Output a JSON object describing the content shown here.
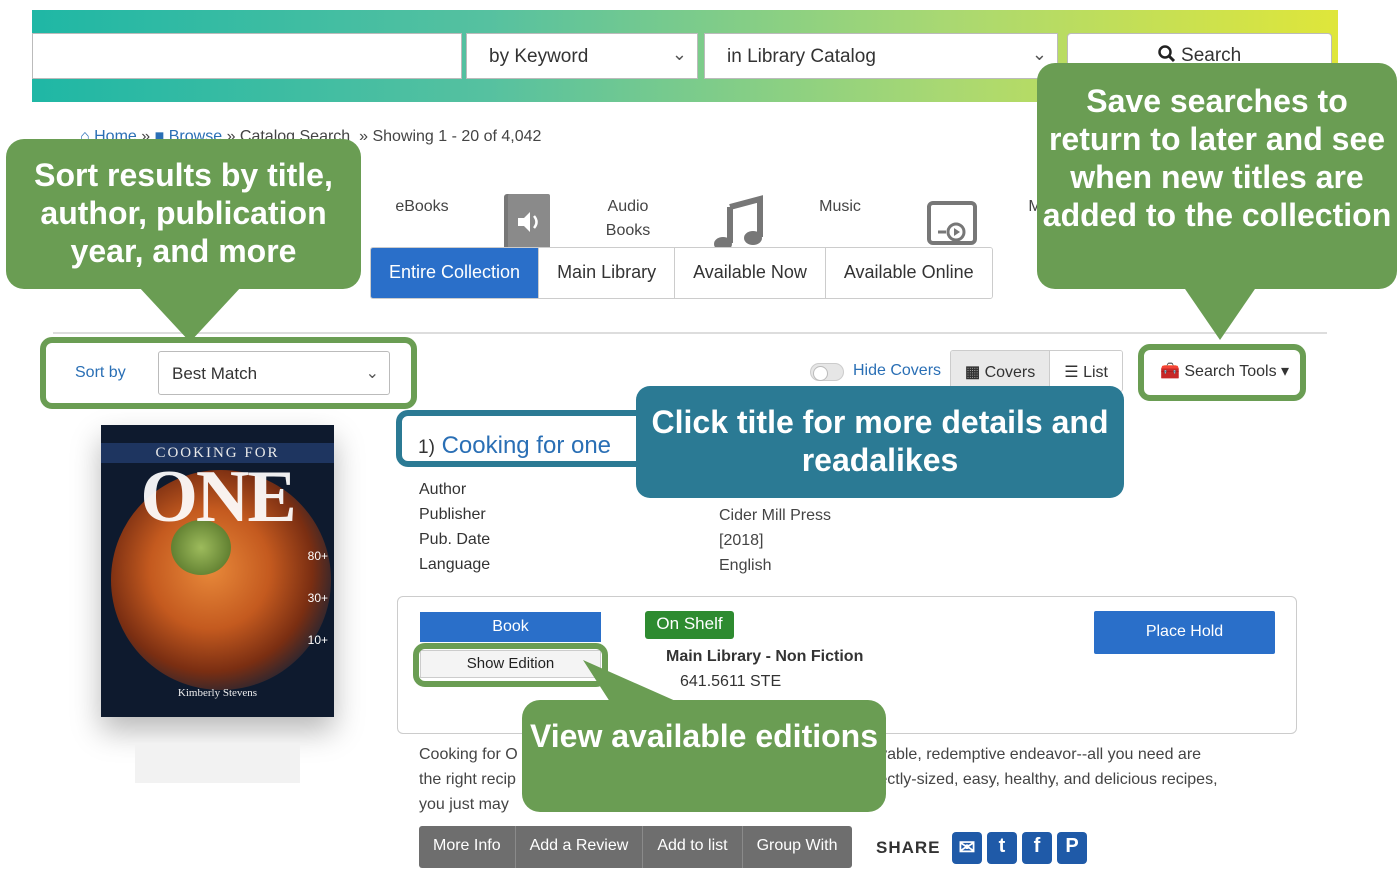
{
  "search": {
    "field_type": "by Keyword",
    "scope": "in Library Catalog",
    "button_label": "Search"
  },
  "breadcrumb": {
    "home": "Home",
    "browse": "Browse",
    "catalog": "» Catalog Search",
    "showing": "» Showing 1 - 20 of 4,042",
    "sep": "»"
  },
  "formats": [
    {
      "label": "eBooks",
      "icon": "ebook-icon"
    },
    {
      "label": "Audio Books",
      "icon": "audiobook-icon"
    },
    {
      "label": "Music",
      "icon": "music-note-icon"
    },
    {
      "label": "M",
      "icon": "video-icon"
    }
  ],
  "location_tabs": [
    {
      "label": "Entire Collection",
      "active": true
    },
    {
      "label": "Main Library",
      "active": false
    },
    {
      "label": "Available Now",
      "active": false
    },
    {
      "label": "Available Online",
      "active": false
    }
  ],
  "sort": {
    "label": "Sort by",
    "value": "Best Match"
  },
  "view": {
    "hide_covers": "Hide Covers",
    "covers": "Covers",
    "list": "List",
    "search_tools": "Search Tools"
  },
  "result": {
    "number": "1)",
    "title": "Cooking for one",
    "meta": [
      {
        "label": "Author",
        "value": ""
      },
      {
        "label": "Publisher",
        "value": "Cider Mill Press"
      },
      {
        "label": "Pub. Date",
        "value": "[2018]"
      },
      {
        "label": "Language",
        "value": "English"
      }
    ],
    "format_button": "Book",
    "show_edition": "Show Edition",
    "status": "On Shelf",
    "location": "Main Library - Non Fiction",
    "call_number": "641.5611 STE",
    "place_hold": "Place Hold",
    "summary_line1_start": "Cooking for O",
    "summary_line1_end": "njoyable, redemptive endeavor--all you need are",
    "summary_line2_start": "the right recip",
    "summary_line2_end": "fectly-sized, easy, healthy, and delicious recipes,",
    "summary_line3_start": "you just may",
    "cover": {
      "top_text": "COOKING FOR",
      "big_text": "ONE",
      "num1": "80+",
      "num2": "30+",
      "num3": "10+",
      "author": "Kimberly Stevens"
    }
  },
  "actions": [
    "More Info",
    "Add a Review",
    "Add to list",
    "Group With"
  ],
  "share": {
    "label": "SHARE",
    "icons": [
      "email-icon",
      "twitter-icon",
      "facebook-icon",
      "pinterest-icon"
    ]
  },
  "callouts": {
    "sort": "Sort results by title, author, publication year, and more",
    "save": "Save searches to return to later and see when new titles are added to the collection",
    "title": "Click title for more details and readalikes",
    "edition": "View available editions"
  },
  "colors": {
    "callout_green": "#6a9d53",
    "callout_blue": "#2b7a94",
    "accent_blue": "#2a6fc9",
    "on_shelf_green": "#2e8b30"
  }
}
